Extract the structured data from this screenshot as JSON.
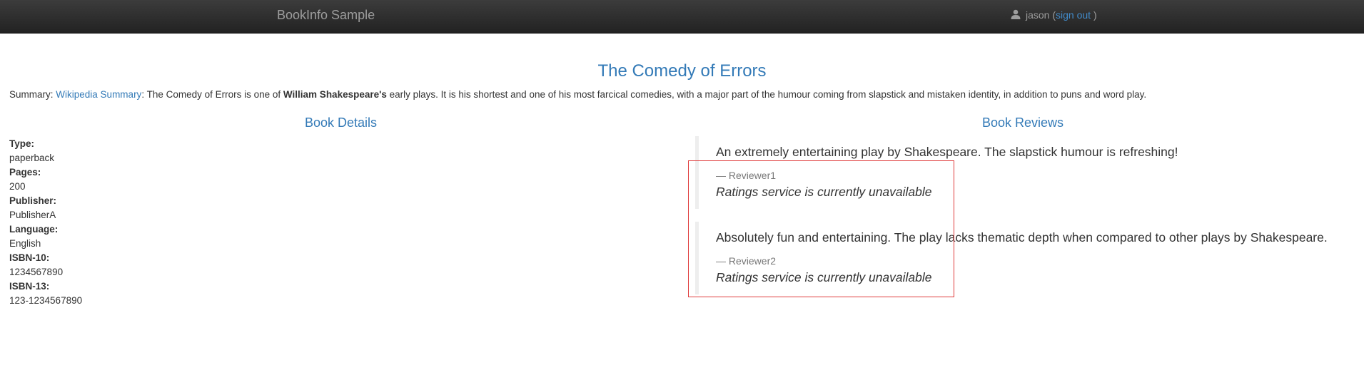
{
  "navbar": {
    "brand": "BookInfo Sample",
    "user_icon": "user-icon",
    "username": "jason",
    "paren_open": "(",
    "signout_label": "sign out",
    "paren_close": ")"
  },
  "book": {
    "title": "The Comedy of Errors",
    "summary_prefix": "Summary:",
    "summary_link": "Wikipedia Summary",
    "summary_text_1": ": The Comedy of Errors is one of",
    "summary_bold": "William Shakespeare's",
    "summary_text_2": "early plays. It is his shortest and one of his most farcical comedies, with a major part of the humour coming from slapstick and mistaken identity, in addition to puns and word play."
  },
  "details": {
    "heading": "Book Details",
    "items": [
      {
        "label": "Type:",
        "value": "paperback"
      },
      {
        "label": "Pages:",
        "value": "200"
      },
      {
        "label": "Publisher:",
        "value": "PublisherA"
      },
      {
        "label": "Language:",
        "value": "English"
      },
      {
        "label": "ISBN-10:",
        "value": "1234567890"
      },
      {
        "label": "ISBN-13:",
        "value": "123-1234567890"
      }
    ]
  },
  "reviews": {
    "heading": "Book Reviews",
    "items": [
      {
        "text": "An extremely entertaining play by Shakespeare. The slapstick humour is refreshing!",
        "reviewer": "— Reviewer1",
        "rating": "Ratings service is currently unavailable"
      },
      {
        "text": "Absolutely fun and entertaining. The play lacks thematic depth when compared to other plays by Shakespeare.",
        "reviewer": "— Reviewer2",
        "rating": "Ratings service is currently unavailable"
      }
    ]
  },
  "colors": {
    "navbar_bg": "#222222",
    "link": "#337ab7",
    "highlight_border": "#e03c3c"
  }
}
